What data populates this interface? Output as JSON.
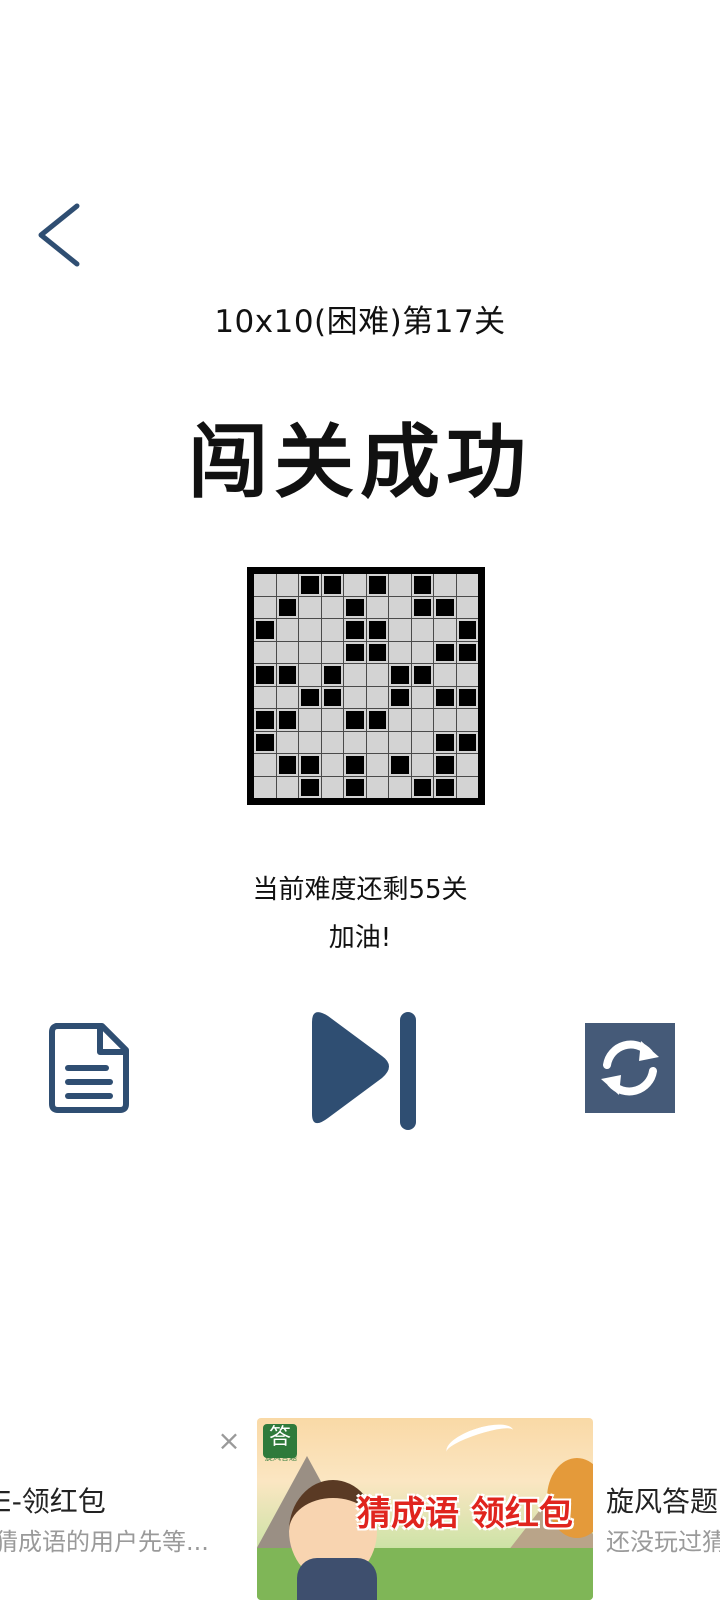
{
  "header": {
    "back_icon": "chevron-left-icon"
  },
  "level": {
    "title": "10x10(困难)第17关",
    "status": "闯关成功"
  },
  "board": {
    "size": 10,
    "rows": [
      "0011010100",
      "0100100110",
      "1000110001",
      "0000110011",
      "1101001100",
      "0011001011",
      "1100110000",
      "1000000011",
      "0110101010",
      "0010100110"
    ]
  },
  "progress": {
    "remaining_text": "当前难度还剩55关",
    "cheer_text": "加油!"
  },
  "actions": {
    "doc_icon": "document-icon",
    "next_icon": "skip-next-icon",
    "refresh_icon": "refresh-icon"
  },
  "ad": {
    "left_title": "E-领红包",
    "left_sub": "猜成语的用户先等...",
    "image_slogan": "猜成语 领红包",
    "image_logo": "答",
    "image_logo_sub": "旋风答题",
    "right_title": "旋风答题",
    "right_sub": "还没玩过猜",
    "close_label": "×"
  },
  "colors": {
    "accent": "#2f4e72",
    "refresh_bg": "#455a78",
    "filled_cell": "#000000",
    "empty_cell": "#d3d3d3"
  }
}
